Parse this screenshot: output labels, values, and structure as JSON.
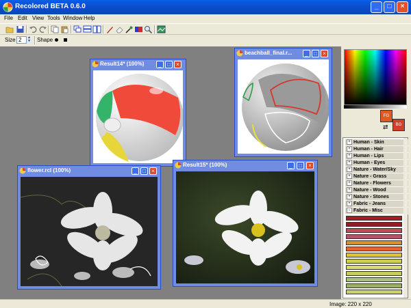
{
  "window": {
    "title": "Recolored BETA 0.6.0"
  },
  "menu": [
    "File",
    "Edit",
    "View",
    "Tools",
    "Window",
    "Help"
  ],
  "toolbar2": {
    "size_label": "Size",
    "size_value": "2",
    "shape_label": "Shape"
  },
  "docs": {
    "result14": {
      "title": "Result14* (100%)"
    },
    "beachball": {
      "title": "beachball_final.r..."
    },
    "flower": {
      "title": "flower.rcl (100%)"
    },
    "result15": {
      "title": "Result15* (100%)"
    }
  },
  "palette": {
    "fg": "FG",
    "bg": "BG",
    "fg_color": "#e05a22",
    "bg_color": "#d2402c"
  },
  "categories": [
    "Human - Skin",
    "Human - Hair",
    "Human - Lips",
    "Human - Eyes",
    "Nature - Water/Sky",
    "Nature - Grass",
    "Nature - Flowers",
    "Nature - Wood",
    "Nature - Stones",
    "Fabric - Jeans",
    "Fabric - Misc"
  ],
  "swatches": [
    "#a51d22",
    "#8e1f28",
    "#c44a5a",
    "#b55368",
    "#d9902a",
    "#e2642e",
    "#e4c12e",
    "#cfcf4a",
    "#d8db6a",
    "#c3cf5a",
    "#a8c07a",
    "#9cae6c",
    "#c9d06c"
  ],
  "status": {
    "image_size": "Image: 220 x 220"
  }
}
